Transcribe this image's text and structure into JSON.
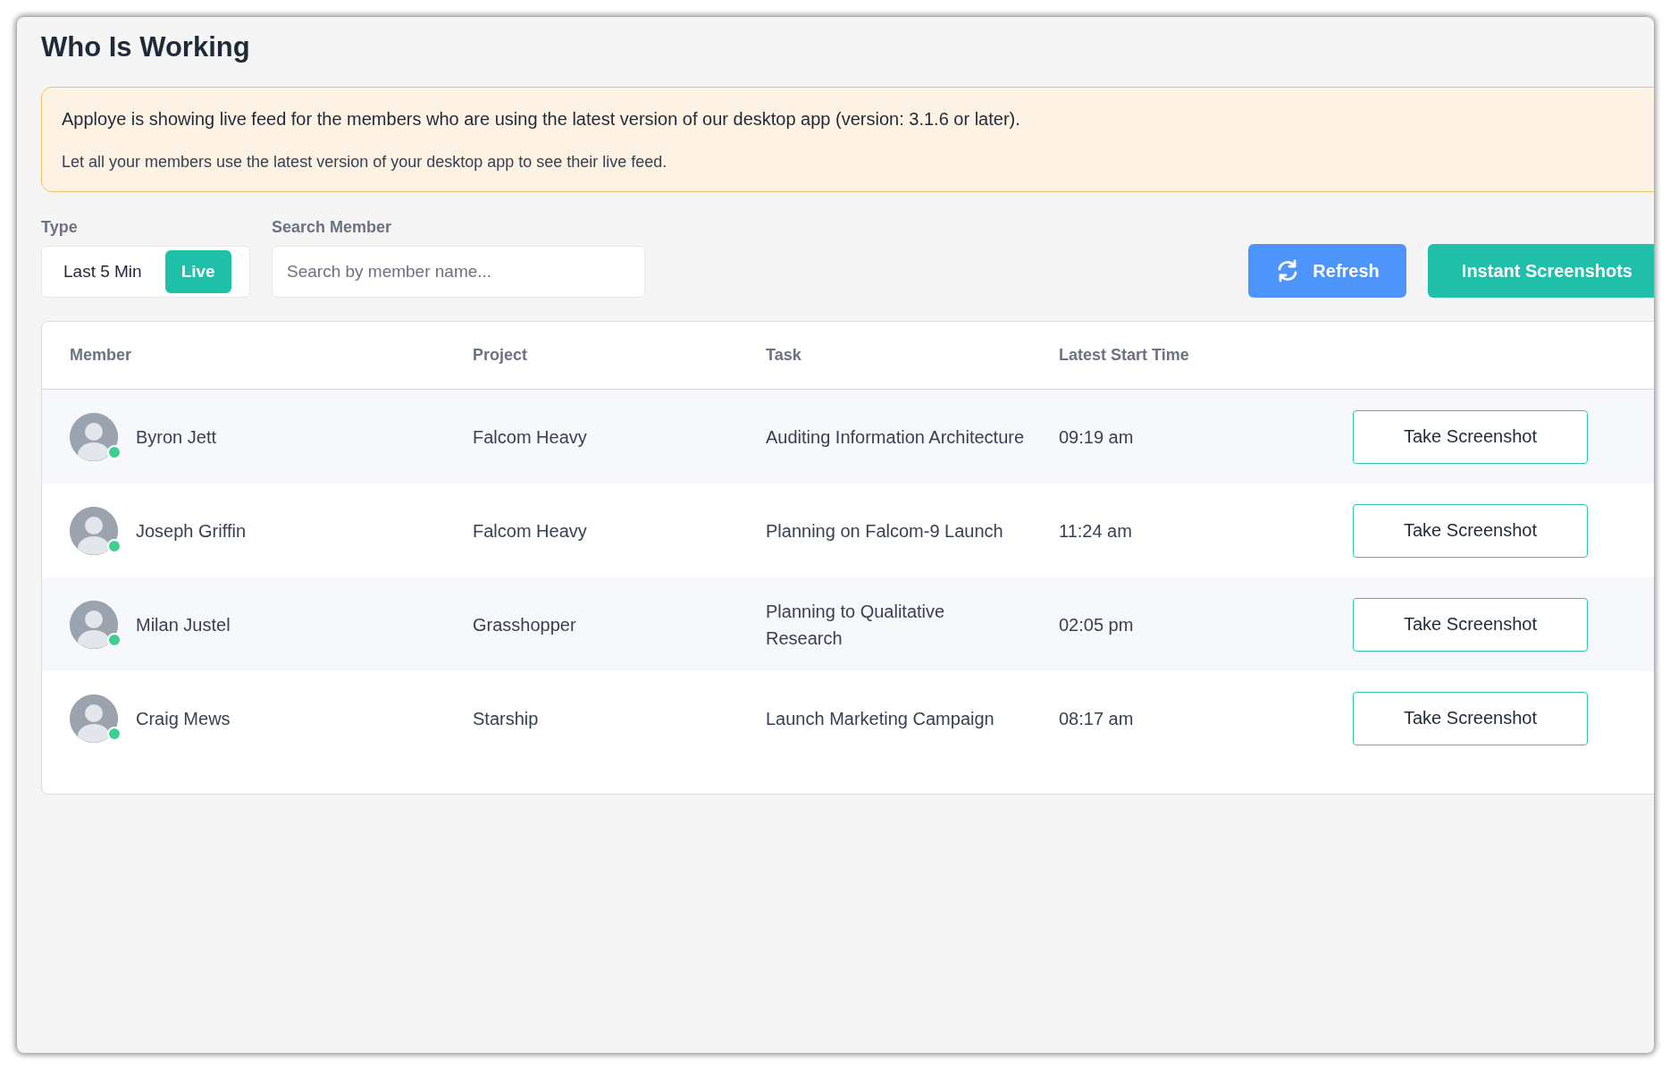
{
  "page": {
    "title": "Who Is Working"
  },
  "notice": {
    "lines": [
      "Apploye is showing live feed for the members who are using the latest version of our desktop app (version: 3.1.6 or later).",
      "Let all your members use the latest version of your desktop app to see their live feed."
    ]
  },
  "filters": {
    "type_label": "Type",
    "type_options": [
      {
        "label": "Last 5 Min",
        "selected": false
      },
      {
        "label": "Live",
        "selected": true
      }
    ],
    "search_label": "Search Member",
    "search": {
      "placeholder": "Search by member name..."
    }
  },
  "actions": [
    {
      "kind": "refresh",
      "label": "Refresh"
    },
    {
      "kind": "primary",
      "label": "Instant Screenshots"
    }
  ],
  "table": {
    "columns": [
      "Member",
      "Project",
      "Task",
      "Latest Start Time"
    ],
    "rows": [
      {
        "member": "Byron Jett",
        "online": true,
        "project": "Falcom Heavy",
        "task": "Auditing Information Architecture",
        "start_time": "09:19 am",
        "action": "Take Screenshot"
      },
      {
        "member": "Joseph Griffin",
        "online": true,
        "project": "Falcom Heavy",
        "task": "Planning on Falcom-9 Launch",
        "start_time": "11:24 am",
        "action": "Take Screenshot"
      },
      {
        "member": "Milan Justel",
        "online": true,
        "project": "Grasshopper",
        "task": "Planning to Qualitative Research",
        "start_time": "02:05 pm",
        "action": "Take Screenshot"
      },
      {
        "member": "Craig Mews",
        "online": true,
        "project": "Starship",
        "task": "Launch Marketing Campaign",
        "start_time": "08:17 am",
        "action": "Take Screenshot"
      }
    ]
  }
}
